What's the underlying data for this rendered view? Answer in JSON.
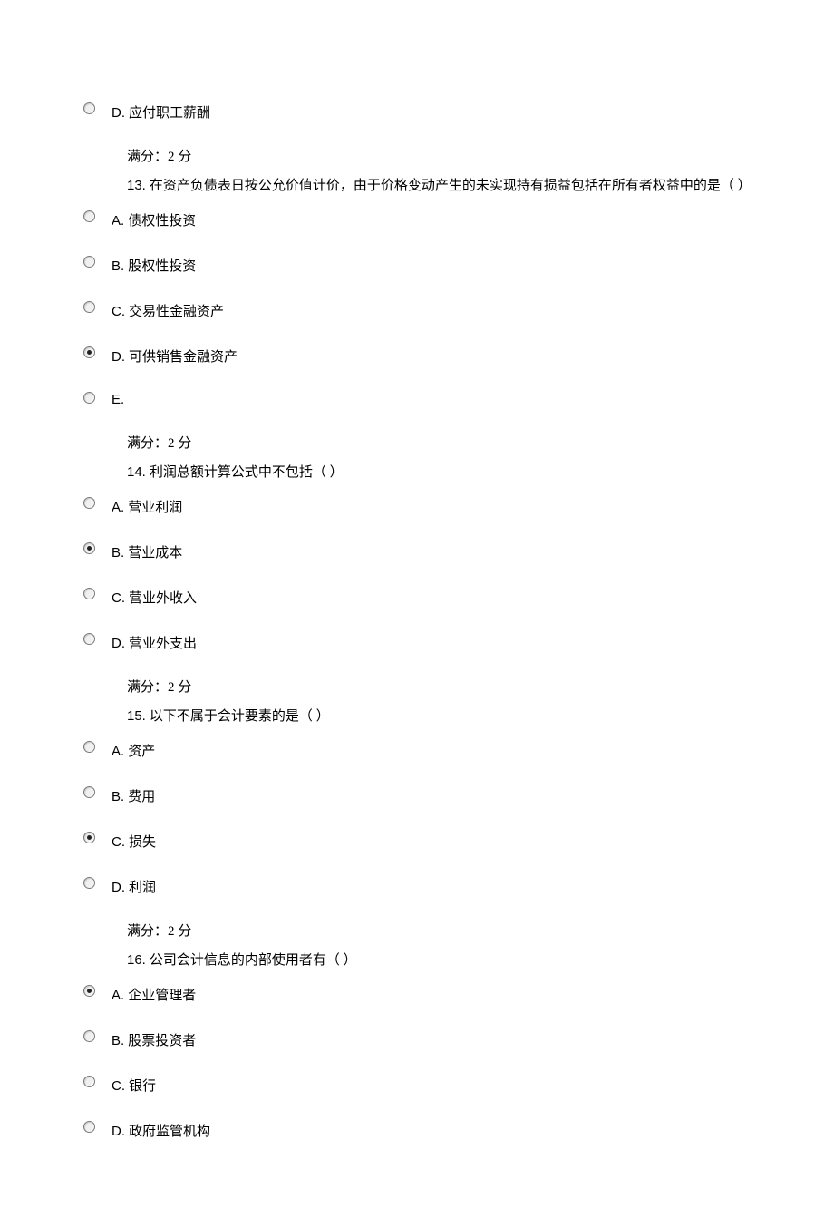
{
  "blocks": [
    {
      "type": "option",
      "letter": "D.",
      "text": "应付职工薪酬",
      "checked": false
    },
    {
      "type": "meta",
      "score": "满分：2 分",
      "qnum": "13.",
      "qtext": "在资产负债表日按公允价值计价，由于价格变动产生的未实现持有损益包括在所有者权益中的是（ ）"
    },
    {
      "type": "option",
      "letter": "A.",
      "text": "债权性投资",
      "checked": false
    },
    {
      "type": "option",
      "letter": "B.",
      "text": "股权性投资",
      "checked": false
    },
    {
      "type": "option",
      "letter": "C.",
      "text": "交易性金融资产",
      "checked": false
    },
    {
      "type": "option",
      "letter": "D.",
      "text": "可供销售金融资产",
      "checked": true
    },
    {
      "type": "option",
      "letter": "E.",
      "text": "",
      "checked": false
    },
    {
      "type": "meta",
      "score": "满分：2 分",
      "qnum": "14.",
      "qtext": "利润总额计算公式中不包括（ ）"
    },
    {
      "type": "option",
      "letter": "A.",
      "text": "营业利润",
      "checked": false
    },
    {
      "type": "option",
      "letter": "B.",
      "text": "营业成本",
      "checked": true
    },
    {
      "type": "option",
      "letter": "C.",
      "text": "营业外收入",
      "checked": false
    },
    {
      "type": "option",
      "letter": "D.",
      "text": "营业外支出",
      "checked": false
    },
    {
      "type": "meta",
      "score": "满分：2 分",
      "qnum": "15.",
      "qtext": "以下不属于会计要素的是（ ）"
    },
    {
      "type": "option",
      "letter": "A.",
      "text": "资产",
      "checked": false
    },
    {
      "type": "option",
      "letter": "B.",
      "text": "费用",
      "checked": false
    },
    {
      "type": "option",
      "letter": "C.",
      "text": "损失",
      "checked": true
    },
    {
      "type": "option",
      "letter": "D.",
      "text": "利润",
      "checked": false
    },
    {
      "type": "meta",
      "score": "满分：2 分",
      "qnum": "16.",
      "qtext": "公司会计信息的内部使用者有（ ）"
    },
    {
      "type": "option",
      "letter": "A.",
      "text": "企业管理者",
      "checked": true
    },
    {
      "type": "option",
      "letter": "B.",
      "text": "股票投资者",
      "checked": false
    },
    {
      "type": "option",
      "letter": "C.",
      "text": "银行",
      "checked": false
    },
    {
      "type": "option",
      "letter": "D.",
      "text": "政府监管机构",
      "checked": false
    }
  ]
}
